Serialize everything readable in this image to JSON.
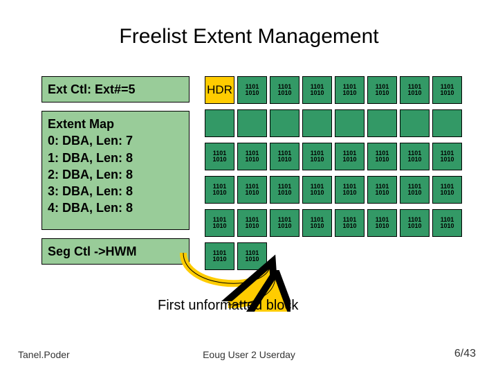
{
  "title": "Freelist Extent Management",
  "sidebar": {
    "extctl": "Ext Ctl: Ext#=5",
    "extmap_title": "Extent Map",
    "extmap_rows": [
      "0: DBA, Len: 7",
      "1: DBA, Len: 8",
      "2: DBA, Len: 8",
      "3: DBA, Len: 8",
      "4: DBA, Len: 8"
    ],
    "segctl": "Seg Ctl ->HWM"
  },
  "grid": {
    "hdr_label": "HDR",
    "bits_line1": "1101",
    "bits_line2": "1010",
    "rows": [
      {
        "cells": [
          "HDR",
          "B",
          "B",
          "B",
          "B",
          "B",
          "B",
          "B"
        ]
      },
      {
        "cells": [
          "E",
          "E",
          "E",
          "E",
          "E",
          "E",
          "E",
          "E"
        ]
      },
      {
        "cells": [
          "B",
          "B",
          "B",
          "B",
          "B",
          "B",
          "B",
          "B"
        ]
      },
      {
        "cells": [
          "B",
          "B",
          "B",
          "B",
          "B",
          "B",
          "B",
          "B"
        ]
      },
      {
        "cells": [
          "B",
          "B",
          "B",
          "B",
          "B",
          "B",
          "B",
          "B"
        ]
      },
      {
        "cells": [
          "B",
          "B"
        ]
      }
    ]
  },
  "caption": "First unformatted block",
  "footer": {
    "left": "Tanel.Poder",
    "center": "Eoug User 2 Userday",
    "right": "6/43"
  },
  "colors": {
    "box_bg": "#99cc99",
    "cell_bg": "#339966",
    "hdr_bg": "#ffcc00",
    "arrow": "#ffcc00"
  }
}
